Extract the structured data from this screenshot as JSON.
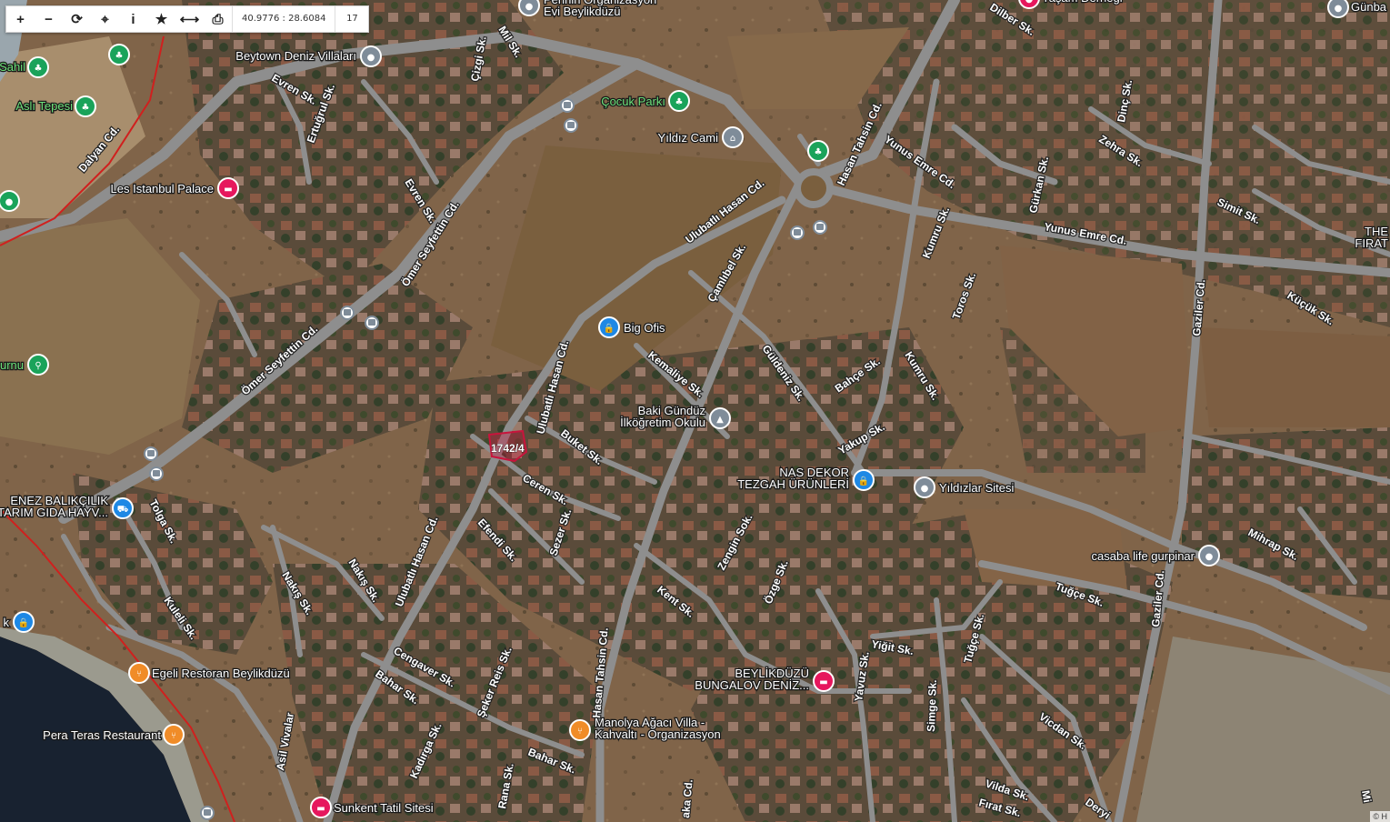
{
  "toolbar": {
    "buttons": [
      {
        "name": "zoom-in-button",
        "glyph": "+"
      },
      {
        "name": "zoom-out-button",
        "glyph": "−"
      },
      {
        "name": "refresh-button",
        "glyph": "⟳"
      },
      {
        "name": "locate-button",
        "glyph": "⌖"
      },
      {
        "name": "info-button",
        "glyph": "i"
      },
      {
        "name": "favorite-button",
        "glyph": "★"
      },
      {
        "name": "measure-button",
        "glyph": "⟷"
      },
      {
        "name": "print-button",
        "glyph": "⎙"
      }
    ],
    "coordinates": "40.9776 : 28.6084",
    "zoom_level": "17"
  },
  "parcel_label": "1742/4",
  "streets": [
    {
      "id": "s1",
      "text": "Dilber Sk."
    },
    {
      "id": "s2",
      "text": "Mil Sk."
    },
    {
      "id": "s3",
      "text": "Çizgi Sk."
    },
    {
      "id": "s4",
      "text": "Evren Sk."
    },
    {
      "id": "s5",
      "text": "Ertuğrul Sk."
    },
    {
      "id": "s6",
      "text": "Dalyan Cd."
    },
    {
      "id": "s7",
      "text": "Evren Sk."
    },
    {
      "id": "s8",
      "text": "Ömer Seyfettin Cd."
    },
    {
      "id": "s9",
      "text": "Ömer Seyfettin Cd."
    },
    {
      "id": "s10",
      "text": "Hasan Tahsin Cd."
    },
    {
      "id": "s11",
      "text": "Dinç Sk."
    },
    {
      "id": "s12",
      "text": "Zehra Sk."
    },
    {
      "id": "s13",
      "text": "Yunus Emre Cd."
    },
    {
      "id": "s14",
      "text": "Gürkan Sk."
    },
    {
      "id": "s15",
      "text": "Yunus Emre Cd."
    },
    {
      "id": "s16",
      "text": "Simit Sk."
    },
    {
      "id": "s17",
      "text": "Küçük Sk."
    },
    {
      "id": "s18",
      "text": "Ulubatlı Hasan Cd."
    },
    {
      "id": "s19",
      "text": "Çamlıbel Sk."
    },
    {
      "id": "s20",
      "text": "Kumru Sk."
    },
    {
      "id": "s21",
      "text": "Toros Sk."
    },
    {
      "id": "s22",
      "text": "Gaziler Cd."
    },
    {
      "id": "s23",
      "text": "Kemaliye Sk."
    },
    {
      "id": "s24",
      "text": "Güldeniz Sk."
    },
    {
      "id": "s25",
      "text": "Bahçe Sk."
    },
    {
      "id": "s26",
      "text": "Kumru Sk."
    },
    {
      "id": "s27",
      "text": "Ulubatlı Hasan Cd."
    },
    {
      "id": "s28",
      "text": "Buket Sk."
    },
    {
      "id": "s29",
      "text": "Yakup Sk."
    },
    {
      "id": "s30",
      "text": "Ceren Sk."
    },
    {
      "id": "s31",
      "text": "Efendi Sk."
    },
    {
      "id": "s32",
      "text": "Sezer Sk."
    },
    {
      "id": "s33",
      "text": "Zengin Sok."
    },
    {
      "id": "s34",
      "text": "Tolga Sk."
    },
    {
      "id": "s35",
      "text": "Nakış Sk."
    },
    {
      "id": "s36",
      "text": "Nakış Sk."
    },
    {
      "id": "s37",
      "text": "Ulubatlı Hasan Cd."
    },
    {
      "id": "s38",
      "text": "Özge Sk."
    },
    {
      "id": "s39",
      "text": "Mihrap Sk."
    },
    {
      "id": "s40",
      "text": "Kuleli Sk."
    },
    {
      "id": "s41",
      "text": "Kent Sk."
    },
    {
      "id": "s42",
      "text": "Tuğçe Sk."
    },
    {
      "id": "s43",
      "text": "Gaziler Cd."
    },
    {
      "id": "s44",
      "text": "Tuğçe Sk."
    },
    {
      "id": "s45",
      "text": "Yiğit Sk."
    },
    {
      "id": "s46",
      "text": "Cengaver Sk."
    },
    {
      "id": "s47",
      "text": "Şeker Reis Sk."
    },
    {
      "id": "s48",
      "text": "Hasan Tahsin Cd."
    },
    {
      "id": "s49",
      "text": "Bahar Sk."
    },
    {
      "id": "s50",
      "text": "Yavuz Sk."
    },
    {
      "id": "s51",
      "text": "Simge Sk."
    },
    {
      "id": "s52",
      "text": "Asil Vivalar"
    },
    {
      "id": "s53",
      "text": "Kadırga Sk."
    },
    {
      "id": "s54",
      "text": "Vicdan Sk."
    },
    {
      "id": "s55",
      "text": "Bahar Sk."
    },
    {
      "id": "s56",
      "text": "Rana Sk."
    },
    {
      "id": "s57",
      "text": "Vilda Sk."
    },
    {
      "id": "s58",
      "text": "Fırat Sk."
    },
    {
      "id": "s59",
      "text": "Deryi"
    },
    {
      "id": "s60",
      "text": "aka Cd."
    },
    {
      "id": "s61",
      "text": "Mi"
    }
  ],
  "pois": [
    {
      "id": "p1",
      "text": "Perihin Organizasyon\nEvi Beylikdüzü",
      "icon": "place-icon",
      "color": "#7f8c99"
    },
    {
      "id": "p2",
      "text": "Yaşam Derneği",
      "icon": "place-icon",
      "color": "#e6175d"
    },
    {
      "id": "p3",
      "text": "Günba",
      "icon": "place-icon",
      "color": "#7f8c99"
    },
    {
      "id": "p4",
      "text": "Beytown Deniz Villaları",
      "icon": "place-icon",
      "color": "#7f8c99"
    },
    {
      "id": "p5",
      "text": "Sahil",
      "icon": "park-icon",
      "color": "#1aa35a"
    },
    {
      "id": "p6",
      "text": "",
      "icon": "park-icon",
      "color": "#1aa35a"
    },
    {
      "id": "p7",
      "text": "Aslı Tepesi",
      "icon": "park-icon",
      "color": "#1aa35a"
    },
    {
      "id": "p8",
      "text": "Çocuk Parkı",
      "icon": "park-icon",
      "color": "#1aa35a"
    },
    {
      "id": "p9",
      "text": "Yıldız Cami",
      "icon": "mosque-icon",
      "color": "#7f8c99"
    },
    {
      "id": "p10",
      "text": "",
      "icon": "park-icon",
      "color": "#1aa35a"
    },
    {
      "id": "p11",
      "text": "",
      "icon": "place-icon",
      "color": "#1aa35a"
    },
    {
      "id": "p12",
      "text": "Les Istanbul Palace",
      "icon": "hotel-icon",
      "color": "#e6175d"
    },
    {
      "id": "p13",
      "text": "THE\nFIRAT",
      "icon": "",
      "color": "#ffffff"
    },
    {
      "id": "p14",
      "text": "Big Ofis",
      "icon": "shop-icon",
      "color": "#1e88e5"
    },
    {
      "id": "p15",
      "text": "urnu",
      "icon": "walk-icon",
      "color": "#1aa35a"
    },
    {
      "id": "p16",
      "text": "Baki Gündüz\nİlköğretim Okulu",
      "icon": "school-icon",
      "color": "#7f8c99"
    },
    {
      "id": "p17",
      "text": "NAS DEKOR\nTEZGAH ÜRÜNLERİ",
      "icon": "shop-icon",
      "color": "#1e88e5"
    },
    {
      "id": "p18",
      "text": "Yıldızlar Sitesi",
      "icon": "place-icon",
      "color": "#7f8c99"
    },
    {
      "id": "p19",
      "text": "ENEZ BALIKÇILIK\nTARIM GIDA HAYV...",
      "icon": "cart-icon",
      "color": "#1e88e5"
    },
    {
      "id": "p20",
      "text": "casaba life gurpinar",
      "icon": "place-icon",
      "color": "#7f8c99"
    },
    {
      "id": "p21",
      "text": "k",
      "icon": "shop-icon",
      "color": "#1e88e5"
    },
    {
      "id": "p22",
      "text": "Egeli Restoran Beylikdüzü",
      "icon": "restaurant-icon",
      "color": "#f08c28"
    },
    {
      "id": "p23",
      "text": "BEYLİKDÜZÜ\nBUNGALOV DENİZ...",
      "icon": "hotel-icon",
      "color": "#e6175d"
    },
    {
      "id": "p24",
      "text": "Pera Teras Restaurant",
      "icon": "restaurant-icon",
      "color": "#f08c28"
    },
    {
      "id": "p25",
      "text": "Manolya Ağacı Villa -\nKahvaltı - Organizasyon",
      "icon": "restaurant-icon",
      "color": "#f08c28"
    },
    {
      "id": "p26",
      "text": "Sunkent Tatil Sitesi",
      "icon": "hotel-icon",
      "color": "#e6175d"
    }
  ],
  "bus_stops": 8,
  "attribution": "© H"
}
